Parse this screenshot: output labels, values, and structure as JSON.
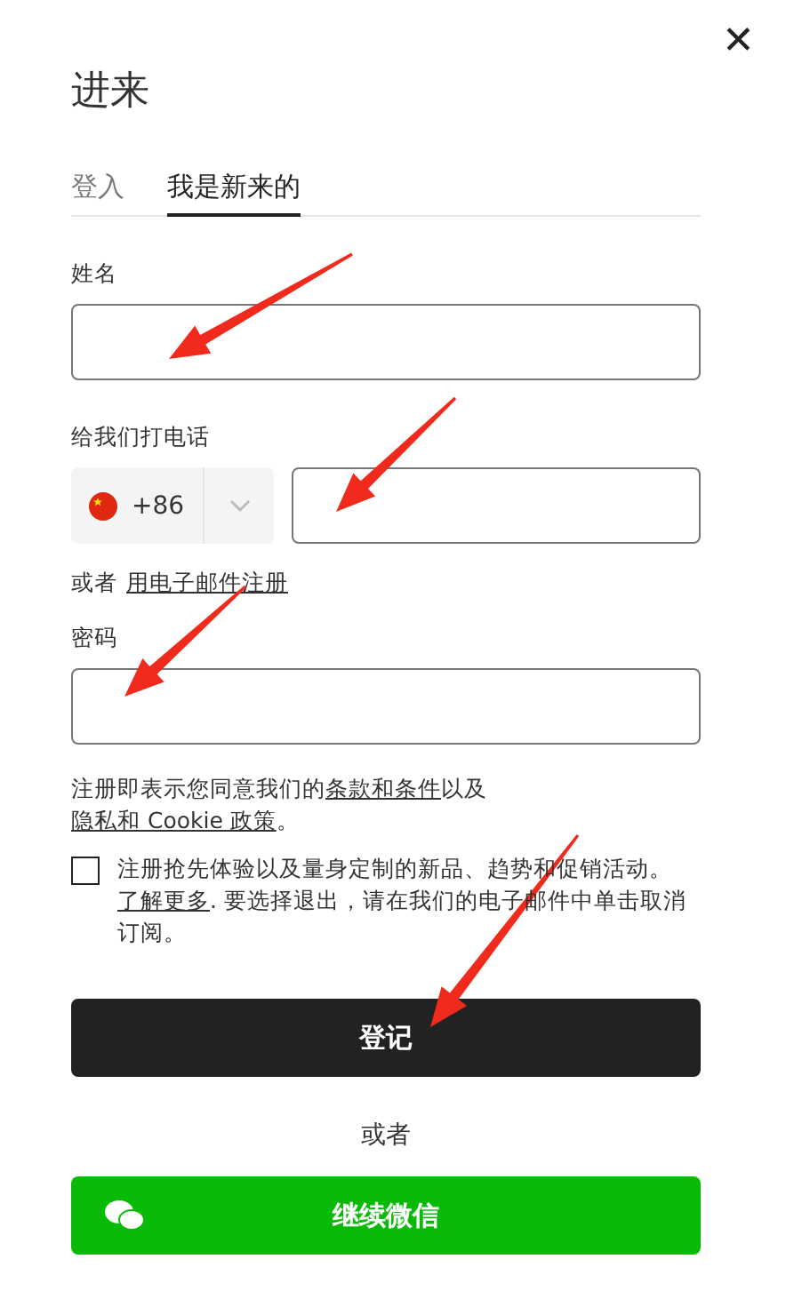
{
  "title": "进来",
  "close_label": "✕",
  "tabs": [
    {
      "label": "登入",
      "selected": false
    },
    {
      "label": "我是新来的",
      "selected": true
    }
  ],
  "name_field": {
    "label": "姓名"
  },
  "phone_field": {
    "label": "给我们打电话",
    "country_code": "+86"
  },
  "email_alt": {
    "prefix": "或者",
    "link": "用电子邮件注册"
  },
  "password_field": {
    "label": "密码"
  },
  "terms": [
    {
      "kind": "text",
      "text": "注册即表示您同意我们的"
    },
    {
      "kind": "link",
      "text": "条款和条件"
    },
    {
      "kind": "text",
      "text": "以及"
    },
    {
      "kind": "link",
      "text": "隐私和 Cookie 政策"
    },
    {
      "kind": "text",
      "text": "。"
    }
  ],
  "marketing": {
    "checked": false,
    "parts": [
      {
        "kind": "text",
        "text": "注册抢先体验以及量身定制的新品、趋势和促销活动。 "
      },
      {
        "kind": "link",
        "text": "了解更多"
      },
      {
        "kind": "text",
        "text": ". 要选择退出，请在我们的电子邮件中单击取消订阅。"
      }
    ]
  },
  "submit_button": "登记",
  "or_text": "或者",
  "wechat_button": "继续微信"
}
